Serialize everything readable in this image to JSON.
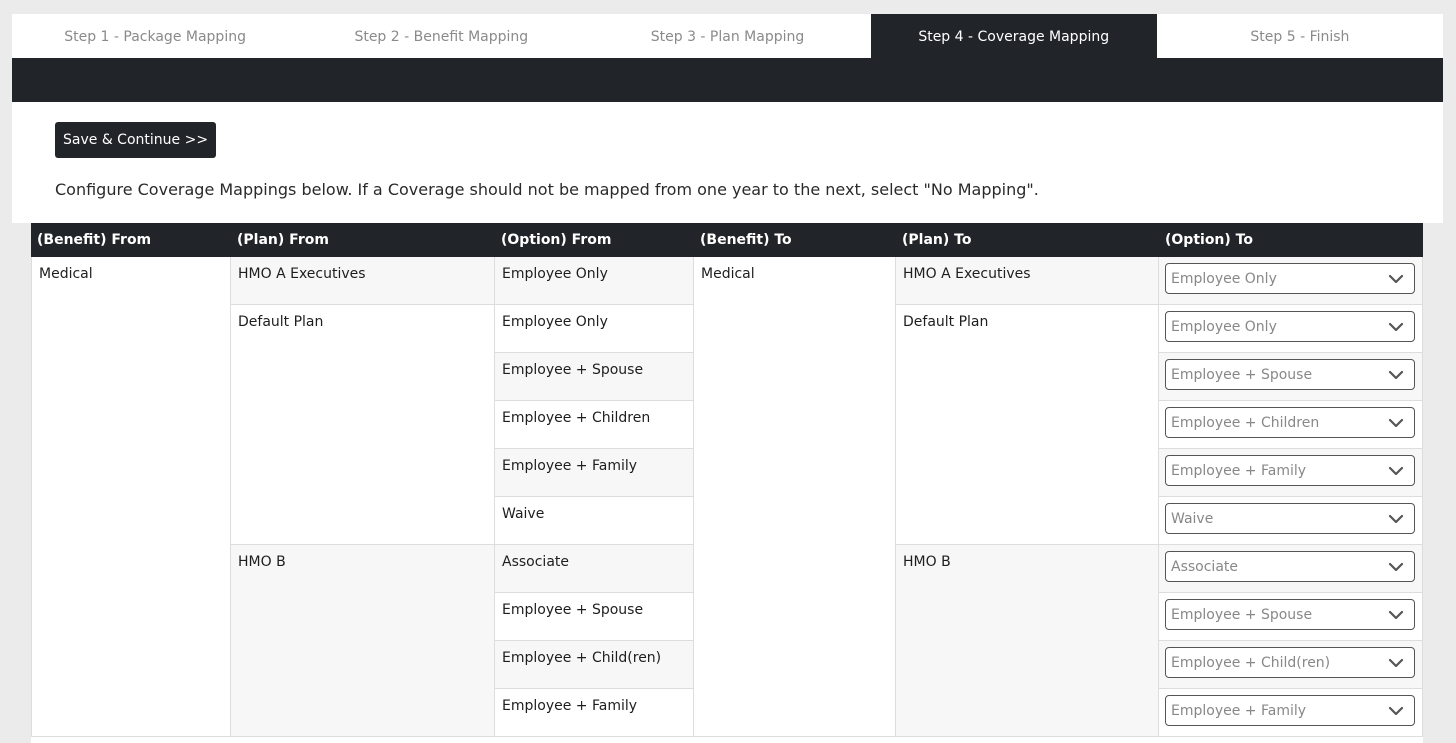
{
  "tabs": [
    {
      "label": "Step 1 - Package Mapping",
      "active": false
    },
    {
      "label": "Step 2 - Benefit Mapping",
      "active": false
    },
    {
      "label": "Step 3 - Plan Mapping",
      "active": false
    },
    {
      "label": "Step 4 - Coverage Mapping",
      "active": true
    },
    {
      "label": "Step 5 - Finish",
      "active": false
    }
  ],
  "panel": {
    "save_label": "Save & Continue >>",
    "instructions": "Configure Coverage Mappings below. If a Coverage should not be mapped from one year to the next, select \"No Mapping\"."
  },
  "table": {
    "headers": [
      "(Benefit) From",
      "(Plan) From",
      "(Option) From",
      "(Benefit) To",
      "(Plan) To",
      "(Option) To"
    ],
    "benefit_from": "Medical",
    "benefit_to": "Medical",
    "plans": [
      {
        "from": "HMO A Executives",
        "to": "HMO A Executives"
      },
      {
        "from": "Default Plan",
        "to": "Default Plan"
      },
      {
        "from": "HMO B",
        "to": "HMO B"
      }
    ],
    "rows": [
      {
        "option_from": "Employee Only",
        "option_to": "Employee Only"
      },
      {
        "option_from": "Employee Only",
        "option_to": "Employee Only"
      },
      {
        "option_from": "Employee + Spouse",
        "option_to": "Employee + Spouse"
      },
      {
        "option_from": "Employee + Children",
        "option_to": "Employee + Children"
      },
      {
        "option_from": "Employee + Family",
        "option_to": "Employee + Family"
      },
      {
        "option_from": "Waive",
        "option_to": "Waive"
      },
      {
        "option_from": "Associate",
        "option_to": "Associate"
      },
      {
        "option_from": "Employee + Spouse",
        "option_to": "Employee + Spouse"
      },
      {
        "option_from": "Employee + Child(ren)",
        "option_to": "Employee + Child(ren)"
      },
      {
        "option_from": "Employee + Family",
        "option_to": "Employee + Family"
      }
    ]
  },
  "icons": {
    "select_chevron": "chevron-down-icon"
  },
  "colors": {
    "dark": "#212429",
    "alt_row": "#f7f7f7",
    "background": "#ebebeb"
  }
}
